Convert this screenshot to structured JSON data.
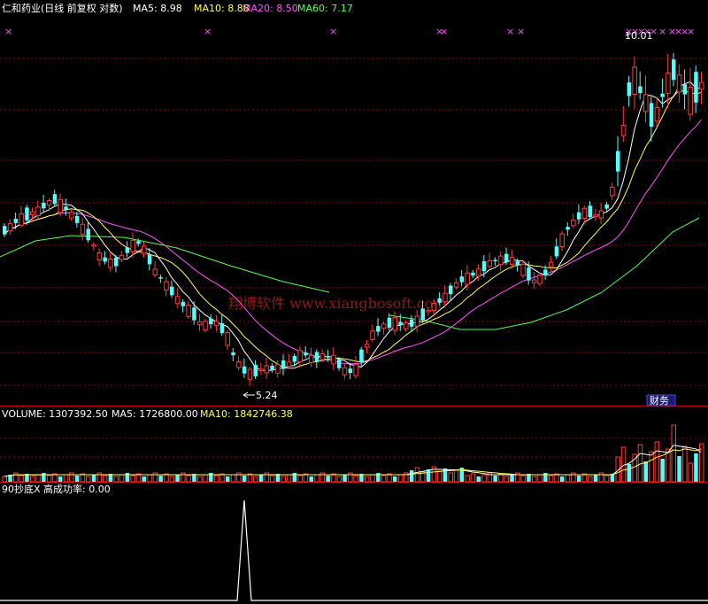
{
  "main_panel": {
    "title": "仁和药业(日线 前复权 对数)",
    "ma5_label": "MA5: 8.98",
    "ma10_label": "MA10: 8.88",
    "ma20_label": "MA20: 8.50",
    "ma60_label": "MA60: 7.17",
    "high_label": "10.01",
    "low_label": "5.24",
    "watermark": "翔博软件 www.xiangbosoft.com",
    "finance_badge": "财务"
  },
  "volume_panel": {
    "label": "VOLUME: 1307392.50",
    "ma5_label": "MA5: 1726800.00",
    "ma10_label": "MA10: 1842746.38"
  },
  "indicator_panel": {
    "label": "90抄底X 高成功率: 0.00"
  },
  "colors": {
    "background": "#000000",
    "up": "#ff3b3b",
    "down": "#54fcfc",
    "ma5": "#ffffff",
    "ma10": "#ffff54",
    "ma20": "#ff54ff",
    "ma60": "#54ff54",
    "grid": "#a00000",
    "signal": "#ff54ff"
  },
  "chart_data": [
    {
      "type": "candlestick",
      "title": "仁和药业(日线 前复权 对数)",
      "scale": "log",
      "annotations": [
        {
          "text": "10.01",
          "kind": "period-high"
        },
        {
          "text": "5.24",
          "kind": "period-low"
        }
      ],
      "series": [
        {
          "name": "MA5",
          "last": 8.98
        },
        {
          "name": "MA10",
          "last": 8.88
        },
        {
          "name": "MA20",
          "last": 8.5
        },
        {
          "name": "MA60",
          "last": 7.17
        }
      ]
    },
    {
      "type": "bar",
      "title": "VOLUME",
      "last_value": 1307392.5,
      "series": [
        {
          "name": "MA5",
          "last": 1726800.0
        },
        {
          "name": "MA10",
          "last": 1842746.38
        }
      ]
    },
    {
      "type": "line",
      "title": "90抄底X 高成功率",
      "last_value": 0.0
    }
  ]
}
